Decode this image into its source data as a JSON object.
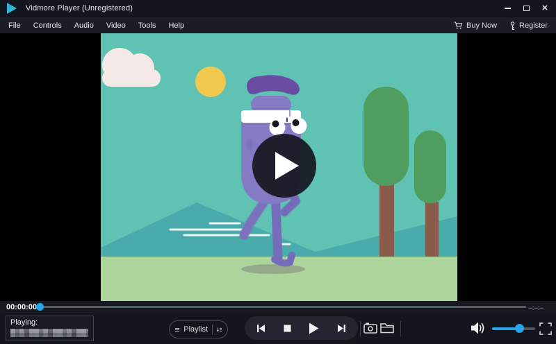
{
  "window": {
    "title": "Vidmore Player (Unregistered)",
    "close_glyph": "✕"
  },
  "menu": {
    "items": [
      "File",
      "Controls",
      "Audio",
      "Video",
      "Tools",
      "Help"
    ],
    "buy_now": "Buy Now",
    "register": "Register"
  },
  "video": {
    "description": "Cartoon scene: purple jogging water-bottle character with white headband, teal sky, sun, cloud, mountains, two trees, green ground, dark play overlay",
    "play_overlay_visible": true
  },
  "seek": {
    "current_time": "00:00:00",
    "total_time": "--:--:--",
    "progress_percent": 0
  },
  "controls": {
    "playing_label": "Playing:",
    "playlist_label": "Playlist",
    "volume_percent": 65
  },
  "colors": {
    "accent_blue": "#29a5ea",
    "titlebar": "#14161f",
    "menubar": "#1a1d26",
    "bottombar": "#14161d",
    "sky": "#5fc2b2",
    "mountain": "#4aabac",
    "grass": "#abd59b",
    "tree_foliage": "#4f9e60",
    "tree_trunk": "#8a5a4a",
    "sun": "#f1c94f",
    "cloud": "#f4e9e7",
    "character_body": "#837cc4",
    "character_cap": "#6a4da3",
    "overlay": "#161820"
  }
}
